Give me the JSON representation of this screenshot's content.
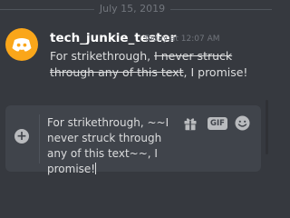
{
  "divider": {
    "date": "July 15, 2019"
  },
  "message": {
    "username": "tech_junkie_tester",
    "timestamp": "Today at 12:07 AM",
    "text_before": "For strikethrough, ",
    "text_strike": "I never struck through any of this text",
    "text_after": ", I promise!"
  },
  "composer": {
    "draft": "For strikethrough, ~~I never struck through any of this text~~, I promise!",
    "gif_label": "GIF"
  },
  "icons": {
    "avatar": "discord-logo-icon",
    "attach": "plus-circle-icon",
    "gift": "gift-icon",
    "emoji": "smiley-face-icon"
  },
  "colors": {
    "background": "#36393f",
    "composer": "#40444b",
    "avatar": "#faa61a",
    "username": "#ffffff",
    "text": "#dcddde",
    "muted": "#72767d"
  }
}
